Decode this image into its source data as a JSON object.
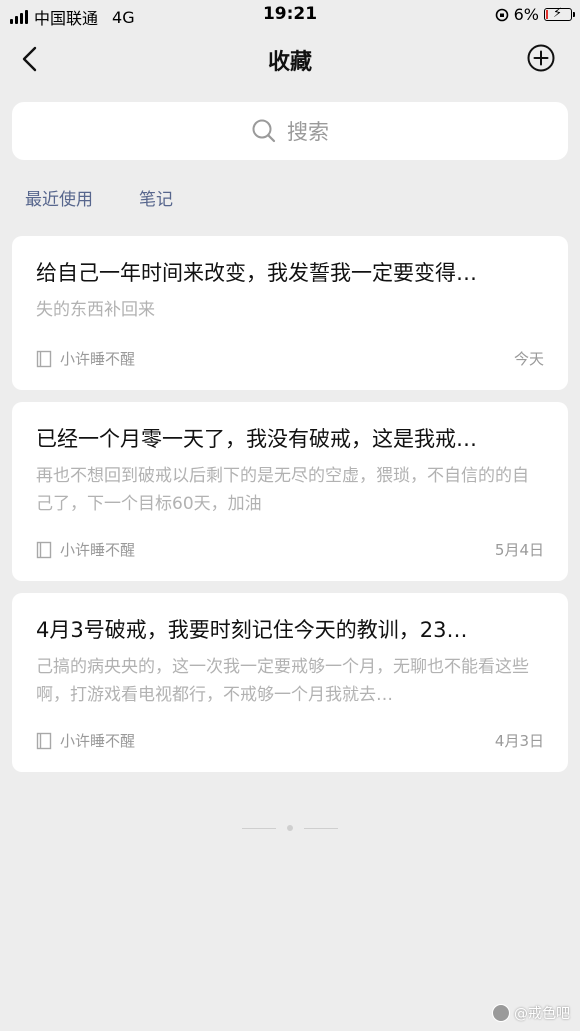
{
  "status_bar": {
    "carrier": "中国联通",
    "network": "4G",
    "time": "19:21",
    "battery_percent": "6%",
    "battery_color": "#e0322f"
  },
  "nav": {
    "title": "收藏",
    "back_icon": "chevron-left-icon",
    "add_icon": "plus-circle-icon"
  },
  "search": {
    "placeholder": "搜索",
    "icon": "search-icon"
  },
  "filters": [
    {
      "label": "最近使用"
    },
    {
      "label": "笔记"
    }
  ],
  "items": [
    {
      "title": "给自己一年时间来改变，我发誓我一定要变得…",
      "body": "失的东西补回来",
      "author": "小许睡不醒",
      "date": "今天"
    },
    {
      "title": "已经一个月零一天了，我没有破戒，这是我戒…",
      "body": "再也不想回到破戒以后剩下的是无尽的空虚，猥琐，不自信的的自己了，下一个目标60天，加油",
      "author": "小许睡不醒",
      "date": "5月4日"
    },
    {
      "title": "4月3号破戒，我要时刻记住今天的教训，23…",
      "body": "己搞的病央央的，这一次我一定要戒够一个月，无聊也不能看这些啊，打游戏看电视都行，不戒够一个月我就去…",
      "author": "小许睡不醒",
      "date": "4月3日"
    }
  ],
  "watermark": "@戒色吧",
  "colors": {
    "background": "#ededed",
    "filter_text": "#57668d",
    "secondary_text": "#b2b2b2"
  }
}
